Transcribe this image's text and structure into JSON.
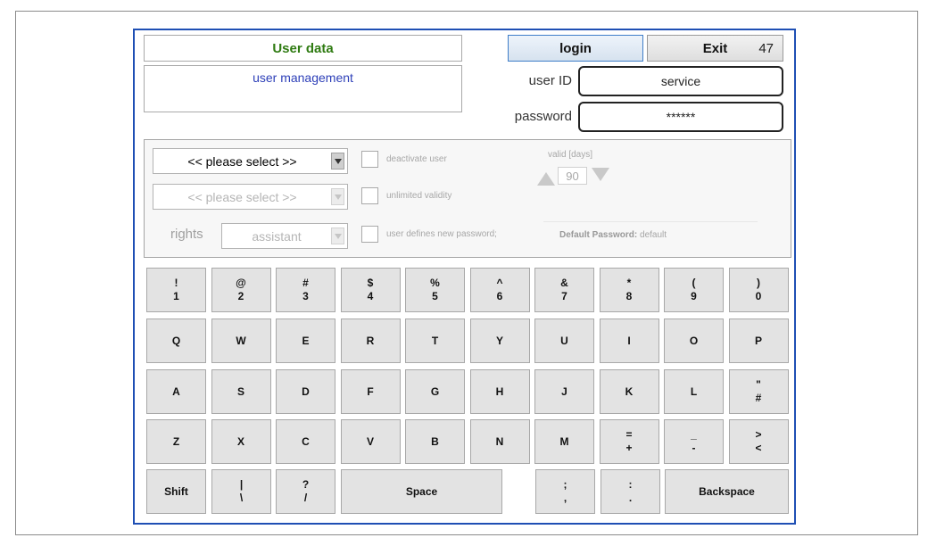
{
  "header": {
    "title": "User data",
    "subtitle": "user management",
    "login_label": "login",
    "exit_label": "Exit",
    "exit_number": "47"
  },
  "credentials": {
    "user_id_label": "user ID",
    "user_id_value": "service",
    "password_label": "password",
    "password_value": "******"
  },
  "options": {
    "user_select": "<< please select >>",
    "second_select": "<< please select >>",
    "rights_label": "rights",
    "rights_value": "assistant",
    "deactivate_label": "deactivate user",
    "unlimited_label": "unlimited validity",
    "user_defines_label": "user defines new password;",
    "valid_label": "valid [days]",
    "valid_value": "90",
    "default_password_label": "Default Password:",
    "default_password_value": "default"
  },
  "keyboard": {
    "rows": [
      [
        {
          "t": "!",
          "b": "1"
        },
        {
          "t": "@",
          "b": "2"
        },
        {
          "t": "#",
          "b": "3"
        },
        {
          "t": "$",
          "b": "4"
        },
        {
          "t": "%",
          "b": "5"
        },
        {
          "t": "^",
          "b": "6"
        },
        {
          "t": "&",
          "b": "7"
        },
        {
          "t": "*",
          "b": "8"
        },
        {
          "t": "(",
          "b": "9"
        },
        {
          "t": ")",
          "b": "0"
        }
      ],
      [
        {
          "t": "",
          "b": "Q"
        },
        {
          "t": "",
          "b": "W"
        },
        {
          "t": "",
          "b": "E"
        },
        {
          "t": "",
          "b": "R"
        },
        {
          "t": "",
          "b": "T"
        },
        {
          "t": "",
          "b": "Y"
        },
        {
          "t": "",
          "b": "U"
        },
        {
          "t": "",
          "b": "I"
        },
        {
          "t": "",
          "b": "O"
        },
        {
          "t": "",
          "b": "P"
        }
      ],
      [
        {
          "t": "",
          "b": "A"
        },
        {
          "t": "",
          "b": "S"
        },
        {
          "t": "",
          "b": "D"
        },
        {
          "t": "",
          "b": "F"
        },
        {
          "t": "",
          "b": "G"
        },
        {
          "t": "",
          "b": "H"
        },
        {
          "t": "",
          "b": "J"
        },
        {
          "t": "",
          "b": "K"
        },
        {
          "t": "",
          "b": "L"
        },
        {
          "t": "\"",
          "b": "#"
        }
      ],
      [
        {
          "t": "",
          "b": "Z"
        },
        {
          "t": "",
          "b": "X"
        },
        {
          "t": "",
          "b": "C"
        },
        {
          "t": "",
          "b": "V"
        },
        {
          "t": "",
          "b": "B"
        },
        {
          "t": "",
          "b": "N"
        },
        {
          "t": "",
          "b": "M"
        },
        {
          "t": "=",
          "b": "+"
        },
        {
          "t": "_",
          "b": "-"
        },
        {
          "t": ">",
          "b": "<"
        }
      ]
    ],
    "bottom": {
      "shift": "Shift",
      "pipe_top": "|",
      "pipe_bottom": "\\",
      "question_top": "?",
      "question_bottom": "/",
      "space": "Space",
      "semicolon_top": ";",
      "semicolon_bottom": ",",
      "colon_top": ":",
      "colon_bottom": ".",
      "backspace": "Backspace"
    }
  }
}
